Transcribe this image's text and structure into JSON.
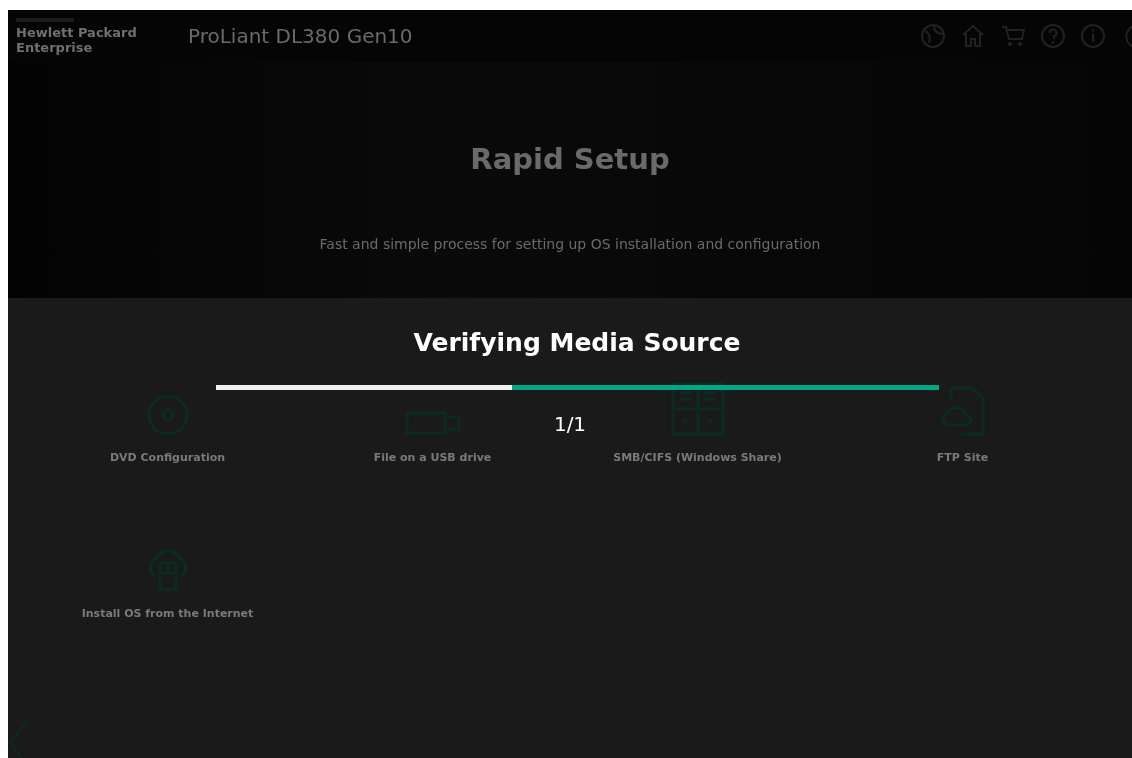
{
  "header": {
    "brand": "Hewlett Packard Enterprise",
    "product": "ProLiant DL380 Gen10"
  },
  "hero": {
    "title": "Rapid Setup",
    "subtitle": "Fast and simple process for setting up OS installation and configuration"
  },
  "options": [
    {
      "kind": "disc",
      "label": "DVD Configuration"
    },
    {
      "kind": "usb",
      "label": "File on a USB drive"
    },
    {
      "kind": "share",
      "label": "SMB/CIFS (Windows Share)"
    },
    {
      "kind": "ftp",
      "label": "FTP Site"
    },
    {
      "kind": "cloud",
      "label": "Install OS from the Internet"
    }
  ],
  "dialog": {
    "title": "Verifying Media Source",
    "progress": {
      "level": 0.41
    },
    "count": "1/1"
  }
}
